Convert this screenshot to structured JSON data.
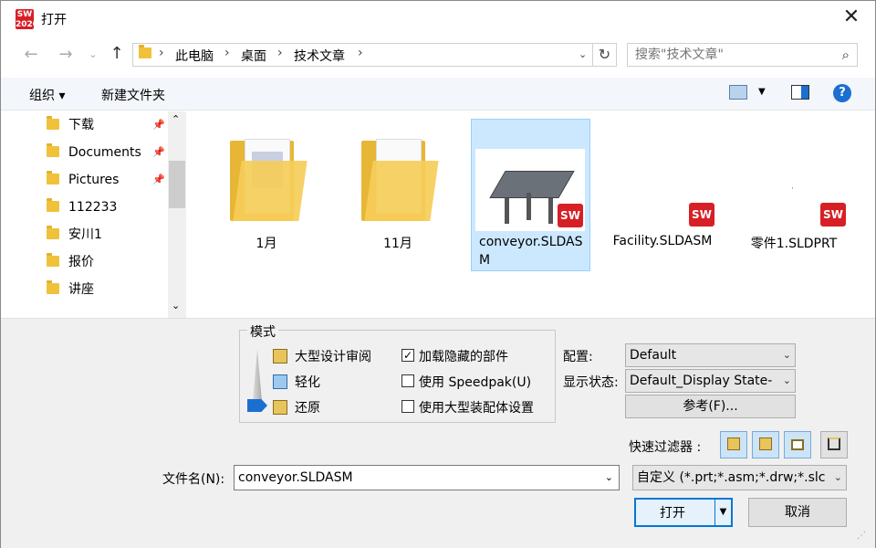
{
  "window": {
    "title": "打开",
    "logo_text": "SW\n2020"
  },
  "address": {
    "segments": [
      "此电脑",
      "桌面",
      "技术文章"
    ]
  },
  "search": {
    "placeholder": "搜索\"技术文章\""
  },
  "toolbar": {
    "organize": "组织 ▾",
    "new_folder": "新建文件夹"
  },
  "sidebar": {
    "items": [
      {
        "label": "下载",
        "pinned": true
      },
      {
        "label": "Documents",
        "pinned": true
      },
      {
        "label": "Pictures",
        "pinned": true
      },
      {
        "label": "112233",
        "pinned": false
      },
      {
        "label": "安川1",
        "pinned": false
      },
      {
        "label": "报价",
        "pinned": false
      },
      {
        "label": "讲座",
        "pinned": false
      }
    ]
  },
  "files": [
    {
      "name": "1月",
      "type": "folder"
    },
    {
      "name": "11月",
      "type": "folder"
    },
    {
      "name": "conveyor.SLDASM",
      "type": "assembly",
      "selected": true
    },
    {
      "name": "Facility.SLDASM",
      "type": "assembly"
    },
    {
      "name": "零件1.SLDPRT",
      "type": "part"
    }
  ],
  "sw_badge": "SW",
  "mode": {
    "title": "模式",
    "options": [
      "大型设计审阅",
      "轻化",
      "还原"
    ],
    "checkboxes": [
      {
        "label": "加载隐藏的部件",
        "checked": true
      },
      {
        "label": "使用 Speedpak(U)",
        "checked": false
      },
      {
        "label": "使用大型装配体设置",
        "checked": false
      }
    ]
  },
  "config": {
    "config_label": "配置:",
    "config_value": "Default",
    "display_label": "显示状态:",
    "display_value": "Default_Display State-",
    "refs_button": "参考(F)..."
  },
  "quick_filter": {
    "label": "快速过滤器 :"
  },
  "filename": {
    "label": "文件名(N):",
    "value": "conveyor.SLDASM",
    "filter_value": "自定义 (*.prt;*.asm;*.drw;*.slc"
  },
  "buttons": {
    "open": "打开",
    "cancel": "取消"
  },
  "colors": {
    "accent": "#cce8ff",
    "sw_red": "#d71f26",
    "folder": "#f0c23b"
  }
}
